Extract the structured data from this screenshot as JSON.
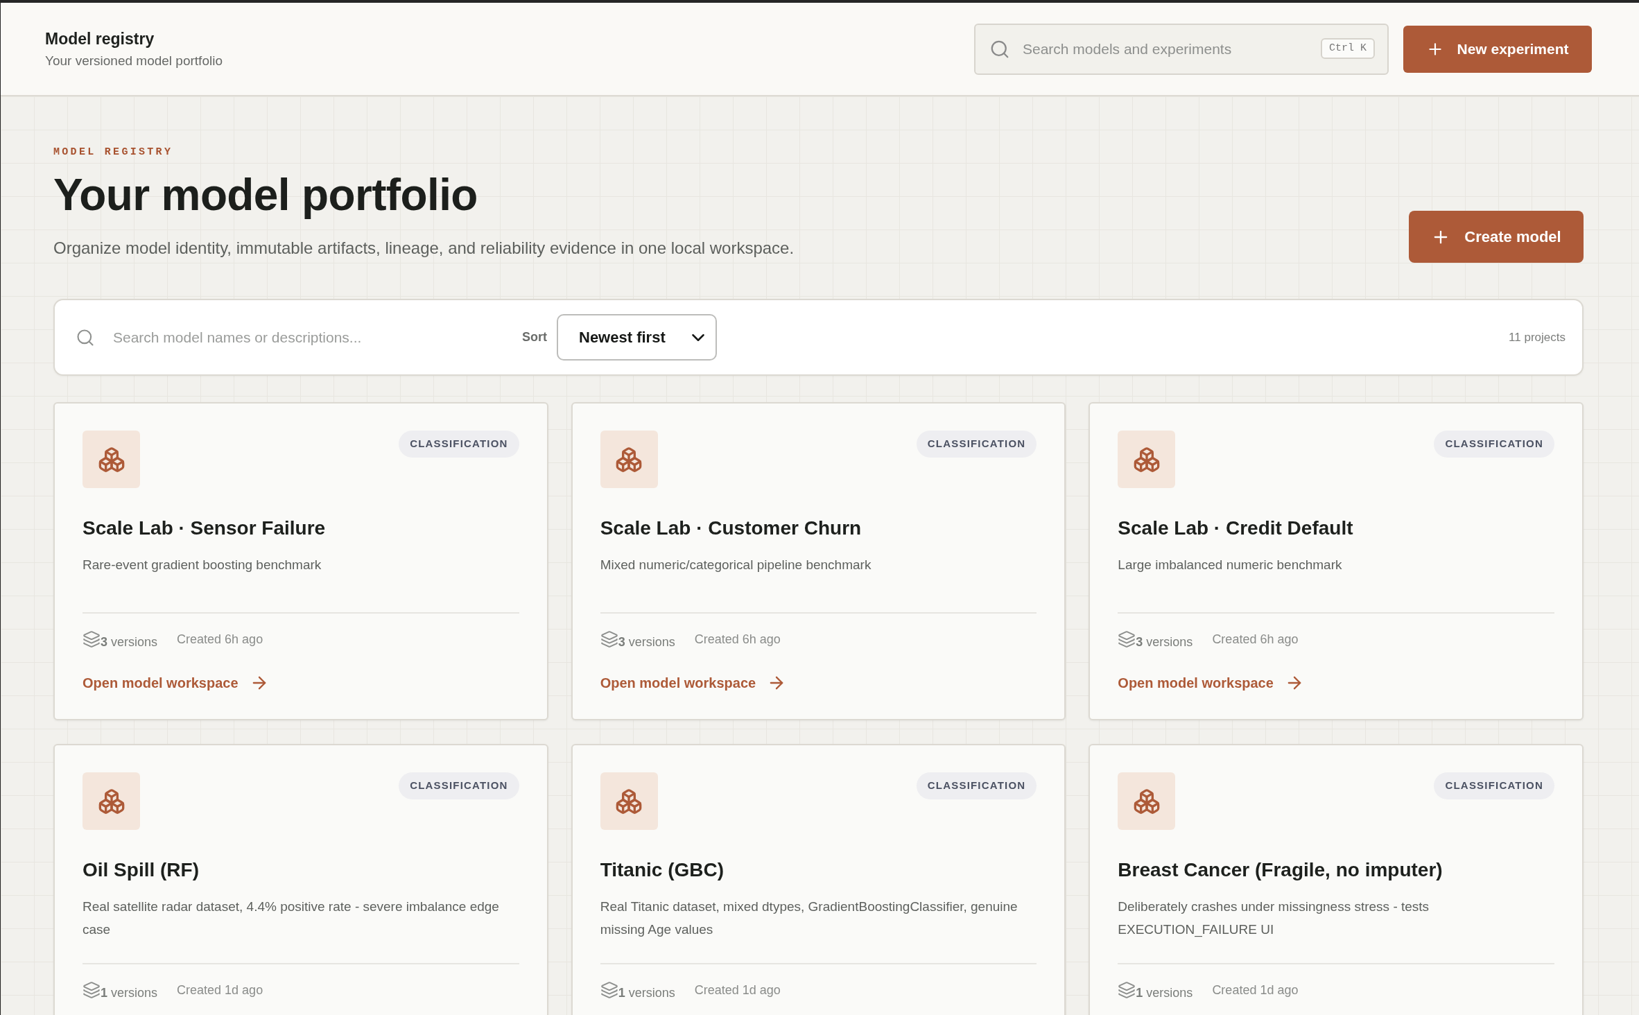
{
  "header": {
    "title": "Model registry",
    "subtitle": "Your versioned model portfolio",
    "search": {
      "placeholder": "Search models and experiments",
      "shortcut": "Ctrl K"
    },
    "primary_button": {
      "label": "New experiment"
    }
  },
  "hero": {
    "eyebrow": "MODEL REGISTRY",
    "title": "Your model portfolio",
    "description": "Organize model identity, immutable artifacts, lineage, and reliability evidence in one local workspace.",
    "button": {
      "label": "Create model"
    }
  },
  "filter_bar": {
    "search": {
      "placeholder": "Search model names or descriptions..."
    },
    "sort": {
      "label": "Sort",
      "value": "Newest first"
    },
    "count": "11 projects"
  },
  "models": [
    {
      "name": "Scale Lab · Sensor Failure",
      "task": "CLASSIFICATION",
      "description": "Rare-event gradient boosting benchmark",
      "versions": "**3** versions",
      "created": "Created 6h ago",
      "link": "Open model workspace"
    },
    {
      "name": "Scale Lab · Customer Churn",
      "task": "CLASSIFICATION",
      "description": "Mixed numeric/categorical pipeline benchmark",
      "versions": "**3** versions",
      "created": "Created 6h ago",
      "link": "Open model workspace"
    },
    {
      "name": "Scale Lab · Credit Default",
      "task": "CLASSIFICATION",
      "description": "Large imbalanced numeric benchmark",
      "versions": "**3** versions",
      "created": "Created 6h ago",
      "link": "Open model workspace"
    },
    {
      "name": "Oil Spill (RF)",
      "task": "CLASSIFICATION",
      "description": "Real satellite radar dataset, 4.4% positive rate - severe imbalance edge case",
      "versions": "**1** versions",
      "created": "Created 1d ago"
    },
    {
      "name": "Titanic (GBC)",
      "task": "CLASSIFICATION",
      "description": "Real Titanic dataset, mixed dtypes, GradientBoostingClassifier, genuine missing Age values",
      "versions": "**1** versions",
      "created": "Created 1d ago"
    },
    {
      "name": "Breast Cancer (Fragile, no imputer)",
      "task": "CLASSIFICATION",
      "description": "Deliberately crashes under missingness stress - tests EXECUTION_FAILURE UI",
      "versions": "**1** versions",
      "created": "Created 1d ago"
    }
  ]
}
